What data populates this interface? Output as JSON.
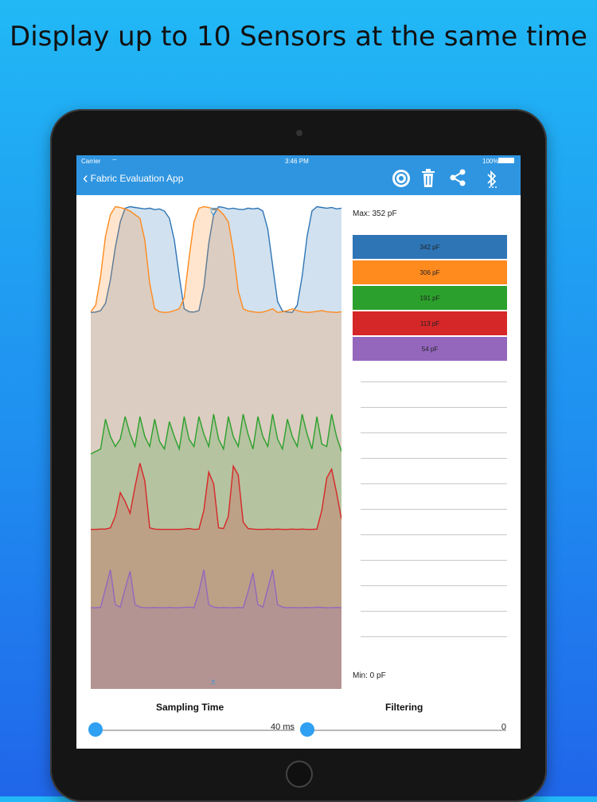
{
  "headline": "Display up to 10 Sensors at the same time",
  "status_bar": {
    "carrier": "Carrier",
    "time": "3:46 PM",
    "battery": "100%"
  },
  "nav": {
    "back_label": "Fabric Evaluation App"
  },
  "colors": {
    "nav_bg": "#2f95e0",
    "accent": "#2f95e0"
  },
  "icons": [
    "record-icon",
    "trash-icon",
    "share-icon",
    "bluetooth-icon"
  ],
  "chart": {
    "max_label": "Max: 352 pF",
    "min_label": "Min: 0 pF"
  },
  "chart_data": {
    "type": "area",
    "ylim": [
      0,
      352
    ],
    "series": [
      {
        "name": "342 pF",
        "color": "#2e75b6",
        "values": [
          50,
          51,
          55,
          75,
          140,
          230,
          300,
          338,
          342,
          340,
          338,
          336,
          338,
          334,
          336,
          330,
          310,
          250,
          150,
          60,
          52,
          51,
          55,
          120,
          240,
          320,
          342,
          340,
          336,
          338,
          335,
          334,
          338,
          336,
          338,
          330,
          280,
          180,
          80,
          54,
          51,
          50,
          70,
          150,
          260,
          330,
          342,
          340,
          338,
          340,
          336,
          338
        ]
      },
      {
        "name": "306 pF",
        "color": "#ff8a1e",
        "values": [
          52,
          70,
          150,
          260,
          320,
          342,
          340,
          336,
          330,
          320,
          310,
          250,
          130,
          60,
          52,
          50,
          51,
          55,
          60,
          90,
          200,
          300,
          338,
          342,
          340,
          336,
          334,
          320,
          300,
          220,
          110,
          60,
          54,
          52,
          50,
          51,
          55,
          60,
          50,
          52,
          55,
          60,
          55,
          52,
          50,
          51,
          53,
          55,
          52,
          51,
          50,
          52
        ]
      },
      {
        "name": "191 pF",
        "color": "#2ca02c",
        "values": [
          80,
          90,
          100,
          220,
          150,
          110,
          140,
          230,
          160,
          110,
          230,
          150,
          110,
          220,
          130,
          100,
          210,
          150,
          100,
          230,
          140,
          110,
          230,
          160,
          110,
          240,
          140,
          100,
          230,
          150,
          110,
          240,
          160,
          100,
          230,
          150,
          110,
          240,
          140,
          100,
          220,
          150,
          110,
          240,
          160,
          100,
          230,
          120,
          110,
          240,
          150,
          90
        ]
      },
      {
        "name": "113 pF",
        "color": "#d62728",
        "values": [
          55,
          55,
          56,
          56,
          60,
          100,
          180,
          150,
          110,
          200,
          280,
          220,
          60,
          56,
          55,
          55,
          55,
          55,
          55,
          56,
          58,
          55,
          56,
          120,
          250,
          210,
          60,
          58,
          100,
          270,
          240,
          80,
          58,
          56,
          55,
          55,
          56,
          55,
          56,
          55,
          55,
          56,
          55,
          56,
          55,
          55,
          56,
          120,
          230,
          260,
          180,
          90
        ]
      },
      {
        "name": "54 pF",
        "color": "#9467bd",
        "values": [
          30,
          30,
          31,
          90,
          150,
          40,
          32,
          90,
          145,
          40,
          32,
          30,
          30,
          31,
          30,
          30,
          31,
          30,
          30,
          31,
          32,
          30,
          80,
          150,
          40,
          32,
          30,
          31,
          30,
          30,
          31,
          30,
          80,
          140,
          40,
          32,
          90,
          150,
          40,
          32,
          30,
          31,
          30,
          30,
          31,
          30,
          32,
          31,
          30,
          30,
          31,
          30
        ]
      }
    ]
  },
  "legend": [
    {
      "label": "342 pF",
      "color": "#2e75b6"
    },
    {
      "label": "306 pF",
      "color": "#ff8a1e"
    },
    {
      "label": "191 pF",
      "color": "#2ca02c"
    },
    {
      "label": "113 pF",
      "color": "#d62728"
    },
    {
      "label": "54 pF",
      "color": "#9467bd"
    }
  ],
  "controls": {
    "sampling": {
      "label": "Sampling Time",
      "value": "40 ms",
      "level": 0.0
    },
    "filtering": {
      "label": "Filtering",
      "value": "0",
      "level": 0.0
    }
  }
}
